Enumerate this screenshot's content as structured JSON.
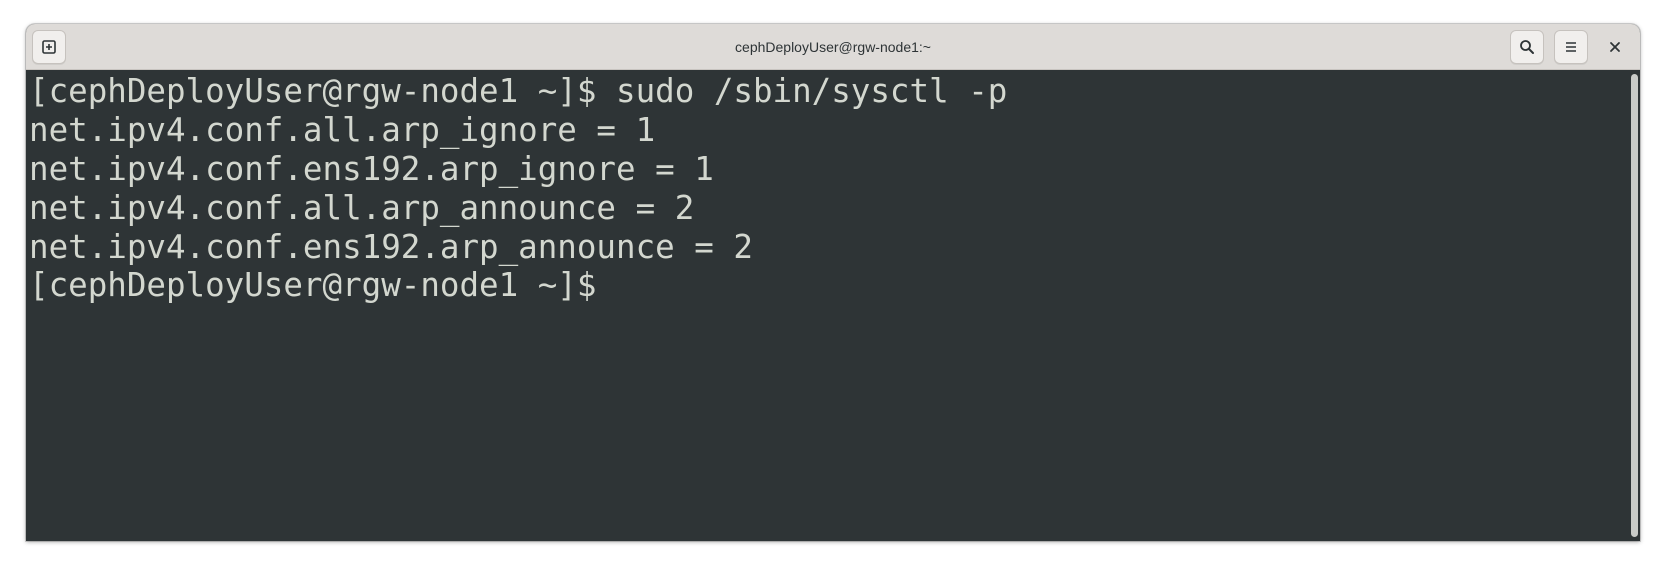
{
  "window": {
    "title": "cephDeployUser@rgw-node1:~"
  },
  "titlebar": {
    "buttons": [
      {
        "name": "new-tab",
        "icon": "new-tab-icon"
      },
      {
        "name": "search",
        "icon": "search-icon"
      },
      {
        "name": "menu",
        "icon": "hamburger-menu-icon"
      },
      {
        "name": "close",
        "icon": "close-icon"
      }
    ]
  },
  "terminal": {
    "background": "#2e3436",
    "foreground": "#d3d7cf",
    "lines": [
      "[cephDeployUser@rgw-node1 ~]$ sudo /sbin/sysctl -p",
      "net.ipv4.conf.all.arp_ignore = 1",
      "net.ipv4.conf.ens192.arp_ignore = 1",
      "net.ipv4.conf.all.arp_announce = 2",
      "net.ipv4.conf.ens192.arp_announce = 2",
      "[cephDeployUser@rgw-node1 ~]$ "
    ]
  }
}
